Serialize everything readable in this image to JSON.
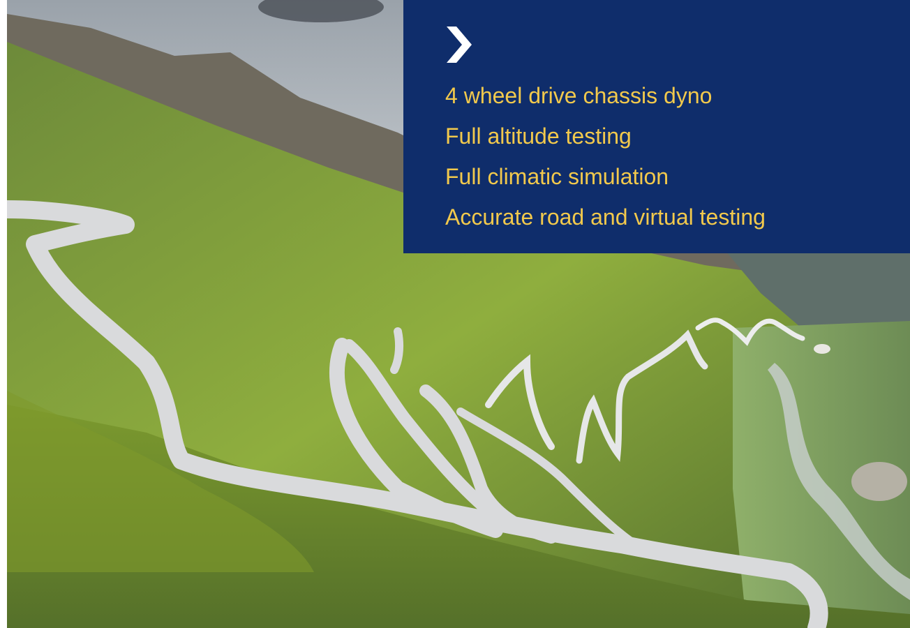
{
  "photo": {
    "subject": "winding mountain pass road"
  },
  "panel": {
    "icon": "chevron-right-icon",
    "background": "#0f2d6b",
    "text_color": "#f2c94c",
    "features": [
      "4 wheel drive chassis dyno",
      "Full altitude testing",
      "Full climatic simulation",
      "Accurate road and virtual testing"
    ]
  }
}
